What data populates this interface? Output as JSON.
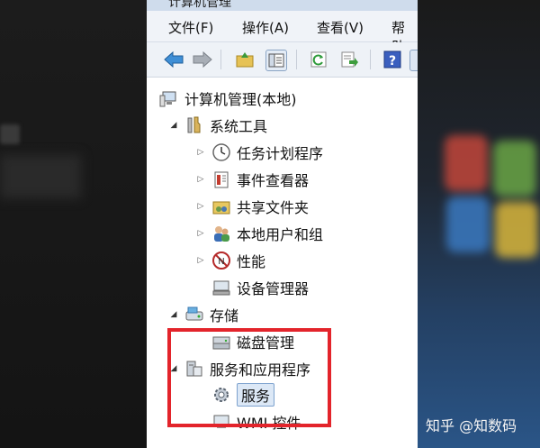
{
  "window": {
    "title": "计算机管理"
  },
  "menu": [
    "文件(F)",
    "操作(A)",
    "查看(V)",
    "帮助"
  ],
  "toolbar": {
    "icons": [
      "back-arrow-icon",
      "forward-arrow-icon",
      "up-folder-icon",
      "show-hide-tree-icon",
      "refresh-icon",
      "export-list-icon",
      "help-icon"
    ]
  },
  "tree": {
    "root": "计算机管理(本地)",
    "system_tools": "系统工具",
    "task_scheduler": "任务计划程序",
    "event_viewer": "事件查看器",
    "shared_folders": "共享文件夹",
    "local_users": "本地用户和组",
    "performance": "性能",
    "device_manager": "设备管理器",
    "storage": "存储",
    "disk_management": "磁盘管理",
    "services_apps": "服务和应用程序",
    "services": "服务",
    "wmi": "WMI 控件"
  },
  "watermark": "知乎 @知数码",
  "colors": {
    "highlight_box": "#e3242b",
    "selection": "#dce8f6"
  }
}
